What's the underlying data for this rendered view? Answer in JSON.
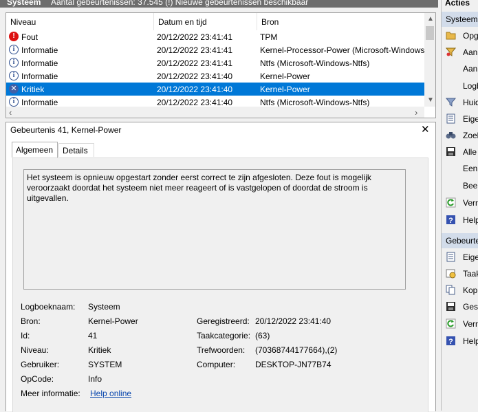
{
  "topbar": {
    "log_name": "Systeem",
    "count_text": "Aantal gebeurtenissen: 37.545 (!) Nieuwe gebeurtenissen beschikbaar"
  },
  "list": {
    "columns": [
      "Niveau",
      "Datum en tijd",
      "Bron"
    ],
    "rows": [
      {
        "level": "Fout",
        "icon": "error-icon",
        "datetime": "20/12/2022 23:41:41",
        "source": "TPM"
      },
      {
        "level": "Informatie",
        "icon": "info-icon",
        "datetime": "20/12/2022 23:41:41",
        "source": "Kernel-Processor-Power (Microsoft-Windows"
      },
      {
        "level": "Informatie",
        "icon": "info-icon",
        "datetime": "20/12/2022 23:41:41",
        "source": "Ntfs (Microsoft-Windows-Ntfs)"
      },
      {
        "level": "Informatie",
        "icon": "info-icon",
        "datetime": "20/12/2022 23:41:40",
        "source": "Kernel-Power"
      },
      {
        "level": "Kritiek",
        "icon": "critical-icon",
        "datetime": "20/12/2022 23:41:40",
        "source": "Kernel-Power",
        "selected": true
      },
      {
        "level": "Informatie",
        "icon": "info-icon",
        "datetime": "20/12/2022 23:41:40",
        "source": "Ntfs (Microsoft-Windows-Ntfs)"
      }
    ]
  },
  "detail": {
    "title": "Gebeurtenis 41, Kernel-Power",
    "tabs": [
      "Algemeen",
      "Details"
    ],
    "description": "Het systeem is opnieuw opgestart zonder eerst correct te zijn afgesloten. Deze fout is mogelijk veroorzaakt doordat het systeem niet meer reageert of is vastgelopen of doordat de stroom is uitgevallen.",
    "fields": {
      "logboeknaam_label": "Logboeknaam:",
      "logboeknaam": "Systeem",
      "bron_label": "Bron:",
      "bron": "Kernel-Power",
      "geregistreerd_label": "Geregistreerd:",
      "geregistreerd": "20/12/2022 23:41:40",
      "id_label": "Id:",
      "id": "41",
      "taakcategorie_label": "Taakcategorie:",
      "taakcategorie": "(63)",
      "niveau_label": "Niveau:",
      "niveau": "Kritiek",
      "trefwoorden_label": "Trefwoorden:",
      "trefwoorden": "(70368744177664),(2)",
      "gebruiker_label": "Gebruiker:",
      "gebruiker": "SYSTEM",
      "computer_label": "Computer:",
      "computer": "DESKTOP-JN77B74",
      "opcode_label": "OpCode:",
      "opcode": "Info",
      "meer_info_label": "Meer informatie:",
      "meer_info_link": "Help online"
    }
  },
  "actions": {
    "title": "Acties",
    "section1": "Systeem",
    "section1_items": [
      {
        "label": "Opg",
        "icon": "folder-open-icon"
      },
      {
        "label": "Aan",
        "icon": "filter-icon"
      },
      {
        "label": "Aan",
        "icon": ""
      },
      {
        "label": "Logb",
        "icon": ""
      },
      {
        "label": "Huid",
        "icon": "filter-icon"
      },
      {
        "label": "Eige",
        "icon": "properties-icon"
      },
      {
        "label": "Zoek",
        "icon": "binoculars-icon"
      },
      {
        "label": "Alle",
        "icon": "save-icon"
      },
      {
        "label": "Een",
        "icon": ""
      },
      {
        "label": "Beel",
        "icon": ""
      },
      {
        "label": "Vern",
        "icon": "refresh-icon"
      },
      {
        "label": "Help",
        "icon": "help-icon"
      }
    ],
    "section2": "Gebeurte",
    "section2_items": [
      {
        "label": "Eige",
        "icon": "properties-icon"
      },
      {
        "label": "Taak",
        "icon": "task-icon"
      },
      {
        "label": "Kop",
        "icon": "copy-icon"
      },
      {
        "label": "Gese",
        "icon": "save-icon"
      },
      {
        "label": "Vern",
        "icon": "refresh-icon"
      },
      {
        "label": "Help",
        "icon": "help-icon"
      }
    ]
  },
  "colors": {
    "selection": "#0078d7",
    "section_bg": "#d2dcea",
    "link": "#0645ad"
  }
}
